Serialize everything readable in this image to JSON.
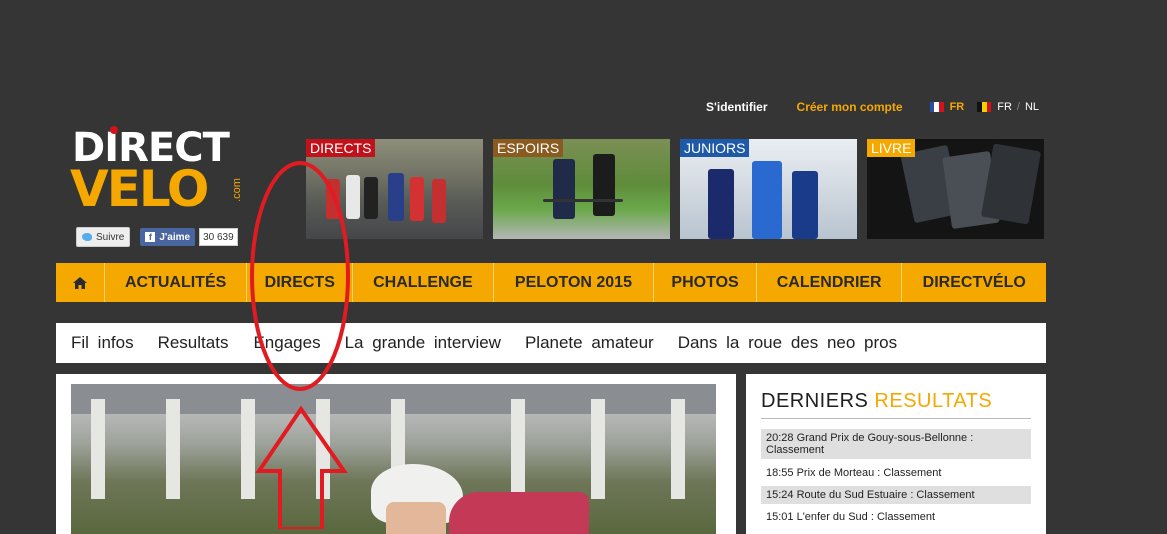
{
  "top": {
    "login": "S'identifier",
    "signup": "Créer mon compte",
    "lang_fr": "FR",
    "lang_be_fr": "FR",
    "lang_sep": "/",
    "lang_nl": "NL"
  },
  "logo": {
    "line1": "DIRECT",
    "line2": "VELO",
    "com": ".com"
  },
  "social": {
    "twitter": "Suivre",
    "facebook": "J'aime",
    "fb_count": "30 639"
  },
  "tiles": [
    {
      "label": "DIRECTS",
      "color": "#c1121c"
    },
    {
      "label": "ESPOIRS",
      "color": "#8a5a1e"
    },
    {
      "label": "JUNIORS",
      "color": "#1e5aa8"
    },
    {
      "label": "LIVRE",
      "color": "#f5a800"
    }
  ],
  "nav": {
    "home_icon": "home-icon",
    "items": [
      "ACTUALITÉS",
      "DIRECTS",
      "CHALLENGE",
      "PELOTON 2015",
      "PHOTOS",
      "CALENDRIER",
      "DIRECTVÉLO"
    ]
  },
  "subnav": {
    "items": [
      "Fil infos",
      "Resultats",
      "Engages",
      "La grande interview",
      "Planete amateur",
      "Dans la roue des neo pros"
    ]
  },
  "results": {
    "title_a": "DERNIERS",
    "title_b": "RESULTATS",
    "rows": [
      "20:28  Grand Prix de Gouy-sous-Bellonne : Classement",
      "18:55  Prix de Morteau : Classement",
      "15:24  Route du Sud Estuaire : Classement",
      "15:01  L'enfer du Sud : Classement"
    ]
  },
  "colors": {
    "accent": "#f5a800",
    "background": "#353535",
    "annotation": "#e11b22"
  }
}
